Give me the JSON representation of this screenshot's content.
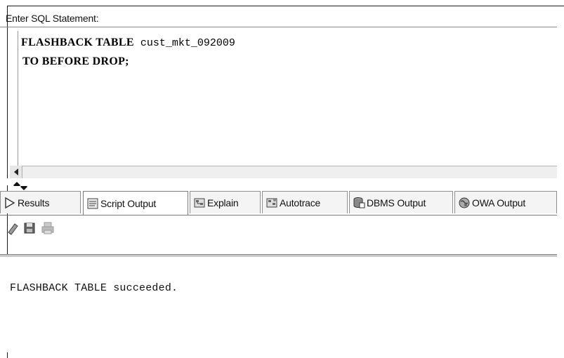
{
  "editor": {
    "label": "Enter SQL Statement:",
    "line1": {
      "keyword": "FLASHBACK TABLE",
      "rest": " cust_mkt_092009"
    },
    "line2": {
      "keyword": "TO BEFORE DROP",
      "rest": ";"
    }
  },
  "tabs": [
    {
      "label": "Results",
      "icon": "play-arrow-icon"
    },
    {
      "label": "Script Output",
      "icon": "script-output-icon",
      "active": true
    },
    {
      "label": "Explain",
      "icon": "explain-plan-icon"
    },
    {
      "label": "Autotrace",
      "icon": "autotrace-icon"
    },
    {
      "label": "DBMS Output",
      "icon": "dbms-output-icon"
    },
    {
      "label": "OWA Output",
      "icon": "owa-output-icon"
    }
  ],
  "toolbar": {
    "icons": [
      "eraser-icon",
      "save-icon",
      "print-icon"
    ]
  },
  "output": {
    "text": "FLASHBACK TABLE succeeded."
  },
  "colors": {
    "frame": "#1a1a1a",
    "tab_border": "#8f8f8f",
    "tab_bg": "#f4f4f4"
  }
}
